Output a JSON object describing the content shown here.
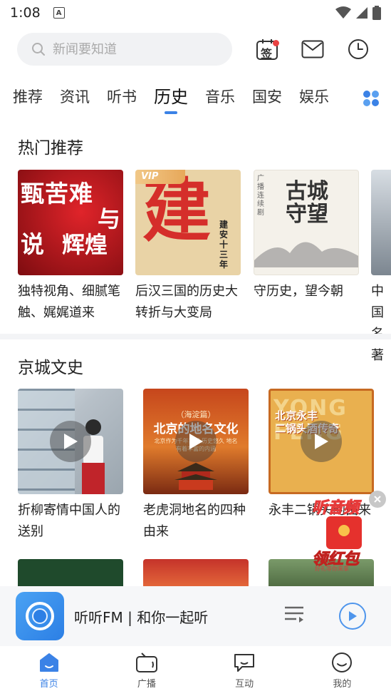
{
  "status_bar": {
    "time": "1:08",
    "notification_letter": "A"
  },
  "search": {
    "placeholder": "新闻要知道"
  },
  "header_icons": {
    "checkin_label": "签",
    "mail": "mail-icon",
    "history": "clock-icon"
  },
  "tabs": [
    {
      "label": "推荐",
      "active": false
    },
    {
      "label": "资讯",
      "active": false
    },
    {
      "label": "听书",
      "active": false
    },
    {
      "label": "历史",
      "active": true
    },
    {
      "label": "音乐",
      "active": false
    },
    {
      "label": "国安",
      "active": false
    },
    {
      "label": "娱乐",
      "active": false
    }
  ],
  "hot": {
    "title": "热门推荐",
    "items": [
      {
        "text": "独特视角、细腻笔触、娓娓道来",
        "cover_text": [
          "甄苦难",
          "说",
          "与",
          "辉煌"
        ]
      },
      {
        "text": "后汉三国的历史大转折与大变局",
        "cover_text": [
          "VIP",
          "建",
          "建安十三年"
        ]
      },
      {
        "text": "守历史，望今朝",
        "cover_text": [
          "古城守望",
          "广播连续剧"
        ]
      },
      {
        "text": "中国名著"
      }
    ]
  },
  "jingcheng": {
    "title": "京城文史",
    "items": [
      {
        "text": "折柳寄情中国人的送别"
      },
      {
        "text": "老虎洞地名的四种由来",
        "cover_text": [
          "（海淀篇）",
          "北京的地名文化",
          "北京作为千年古都 历史悠久 地名有着丰富的内涵"
        ]
      },
      {
        "text": "永丰二锅头的由来",
        "cover_text": [
          "YONG FENG",
          "北京永丰",
          "二锅头酒传奇"
        ]
      }
    ]
  },
  "float_ad": {
    "top": "听音频",
    "bottom": "领红包",
    "small": "好礼等你来拿"
  },
  "player": {
    "title": "听听FM | 和你一起听"
  },
  "bottom_nav": [
    {
      "label": "首页",
      "active": true
    },
    {
      "label": "广播",
      "active": false
    },
    {
      "label": "互动",
      "active": false
    },
    {
      "label": "我的",
      "active": false
    }
  ],
  "colors": {
    "accent": "#3b82e6",
    "badge": "#e94343"
  }
}
